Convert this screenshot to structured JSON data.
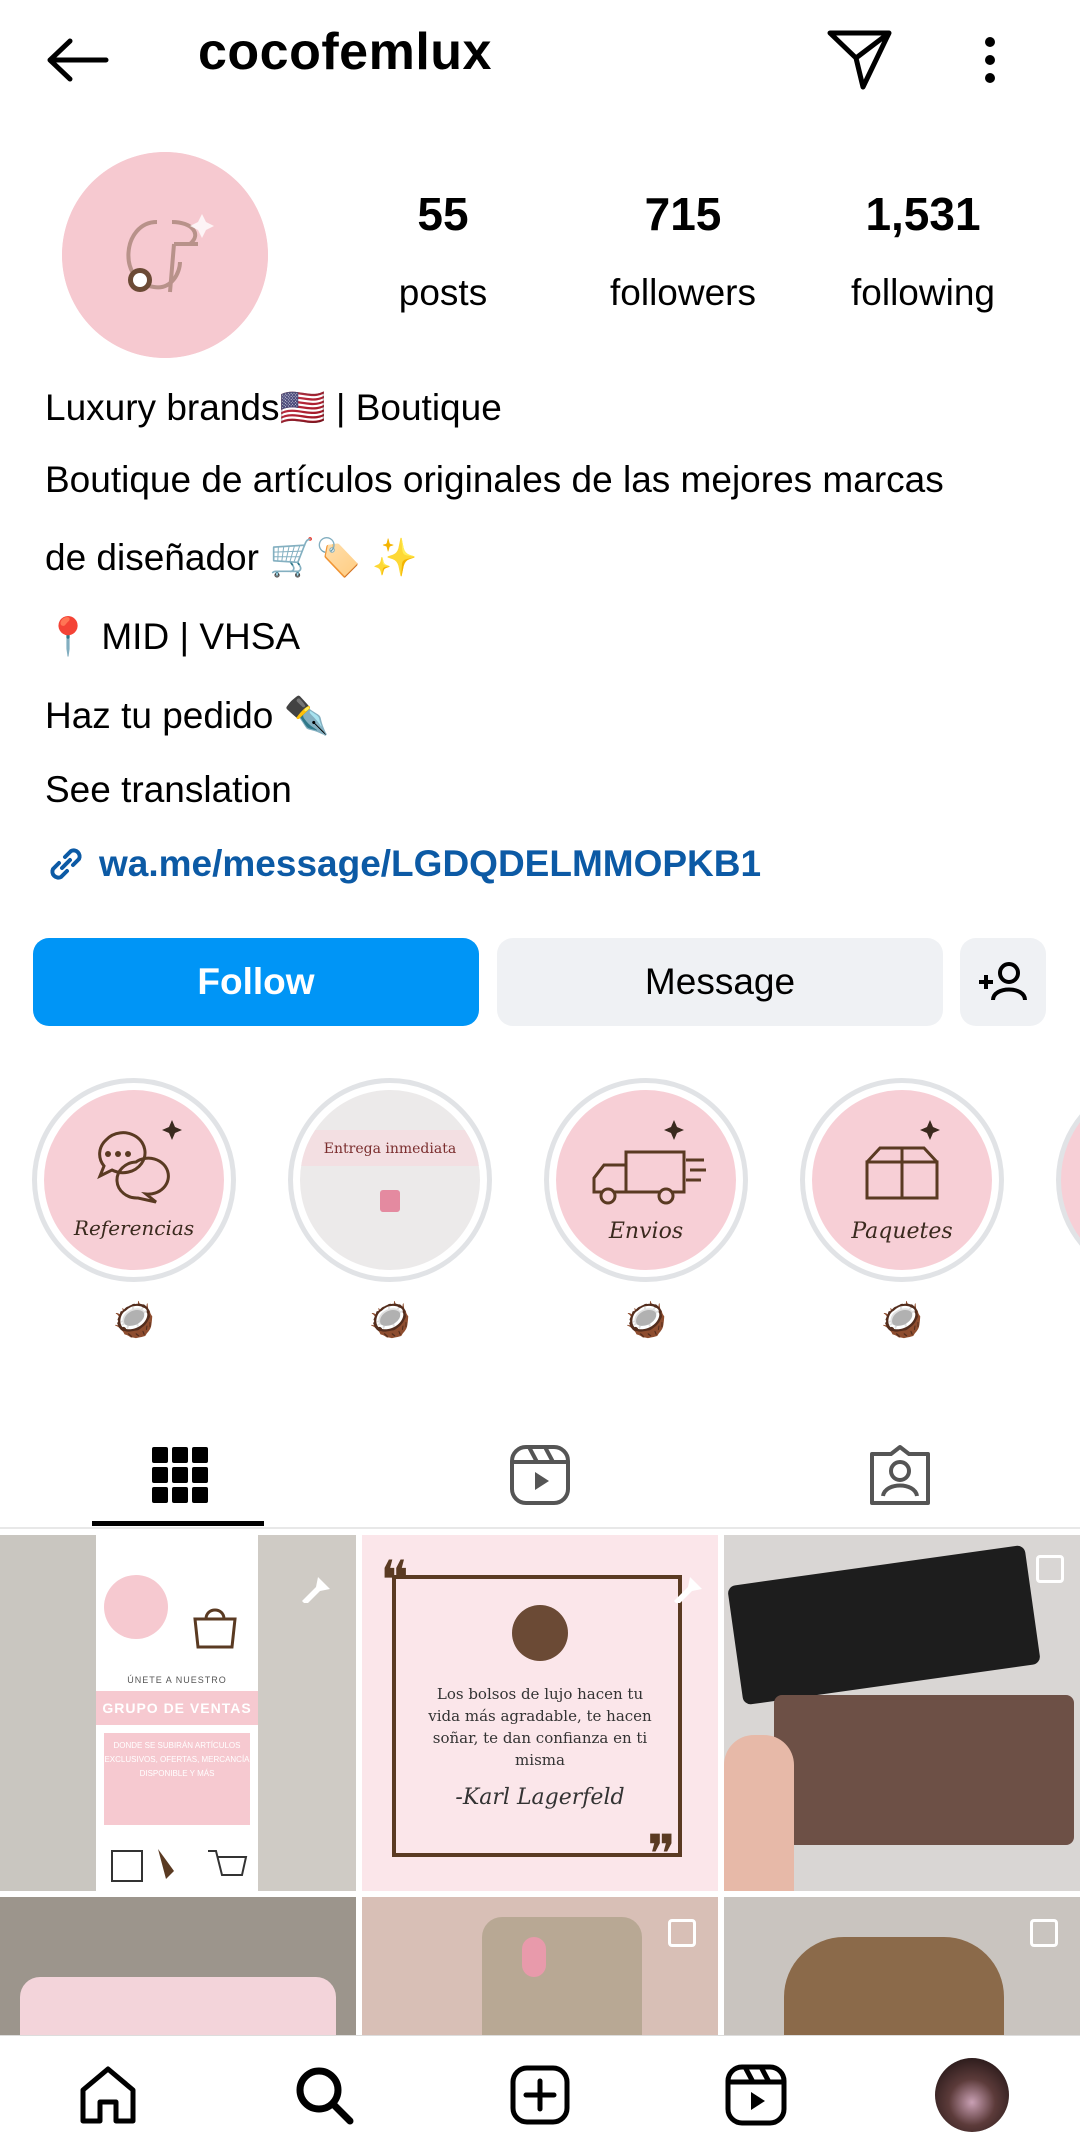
{
  "header": {
    "username": "cocofemlux",
    "back_icon": "arrow-left-icon",
    "send_icon": "paper-plane-icon",
    "more_icon": "more-vertical-icon"
  },
  "profile": {
    "avatar_text": "CF",
    "stats": [
      {
        "value": "55",
        "label": "posts"
      },
      {
        "value": "715",
        "label": "followers"
      },
      {
        "value": "1,531",
        "label": "following"
      }
    ],
    "bio": {
      "line1": "Luxury brands🇺🇸 | Boutique",
      "line2": "Boutique de artículos originales de las mejores marcas",
      "line3": "de diseñador 🛒🏷️ ✨",
      "line4": "📍 MID | VHSA",
      "line5": "Haz tu pedido ✒️",
      "see_translation": "See translation",
      "link": "wa.me/message/LGDQDELMMOPKB1"
    }
  },
  "actions": {
    "follow": "Follow",
    "message": "Message"
  },
  "highlights": [
    {
      "cover_text": "Referencias",
      "label": "🥥"
    },
    {
      "cover_text": "Entrega inmediata",
      "label": "🥥"
    },
    {
      "cover_text": "Envios",
      "label": "🥥"
    },
    {
      "cover_text": "Paquetes",
      "label": "🥥"
    }
  ],
  "tabs": [
    "grid-icon",
    "reels-icon",
    "tagged-icon"
  ],
  "posts": {
    "post1": {
      "title": "ÚNETE A NUESTRO",
      "heading": "GRUPO DE VENTAS",
      "body": "DONDE SE SUBIRÁN ARTÍCULOS EXCLUSIVOS, OFERTAS, MERCANCÍA DISPONIBLE Y MÁS"
    },
    "post2": {
      "quote": "Los bolsos de lujo hacen tu vida más agradable, te hacen soñar, te dan confianza en ti misma",
      "author": "-Karl Lagerfeld"
    }
  },
  "bottom_nav": [
    "home-icon",
    "search-icon",
    "create-icon",
    "reels-icon",
    "profile-avatar"
  ],
  "colors": {
    "accent": "#0095f6",
    "link": "#0c5aa5",
    "pink": "#f7cfd6",
    "brown": "#5a3a22"
  }
}
